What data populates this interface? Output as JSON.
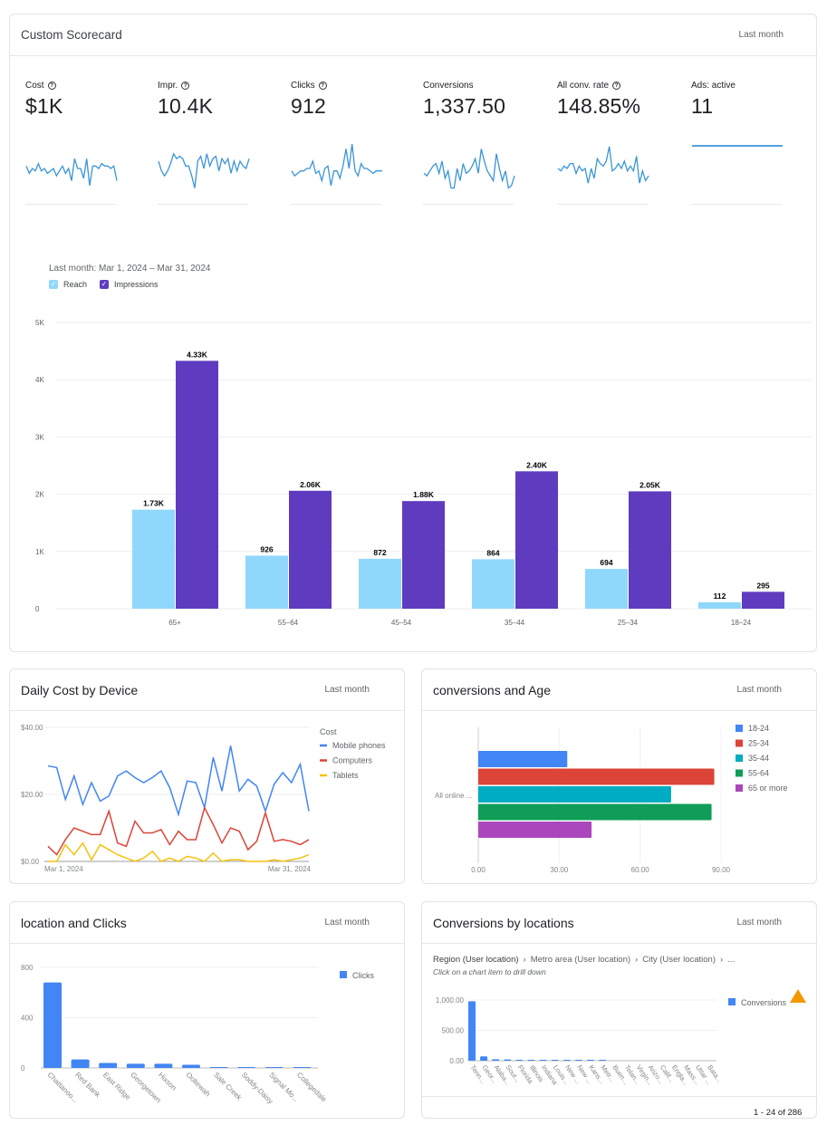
{
  "scorecard": {
    "title": "Custom Scorecard",
    "range": "Last month",
    "metrics": [
      {
        "label": "Cost",
        "value": "$1K",
        "help": true,
        "spark": [
          0.45,
          0.6,
          0.5,
          0.55,
          0.4,
          0.55,
          0.5,
          0.6,
          0.55,
          0.5,
          0.65,
          0.55,
          0.45,
          0.6,
          0.5,
          0.75,
          0.3,
          0.5,
          0.5,
          0.7,
          0.3,
          0.85,
          0.45,
          0.45,
          0.5,
          0.4,
          0.45,
          0.45,
          0.5,
          0.45,
          0.75
        ]
      },
      {
        "label": "Impr.",
        "value": "10.4K",
        "help": true,
        "spark": [
          0.35,
          0.55,
          0.65,
          0.55,
          0.4,
          0.2,
          0.3,
          0.25,
          0.3,
          0.45,
          0.45,
          0.65,
          0.9,
          0.35,
          0.25,
          0.5,
          0.2,
          0.45,
          0.3,
          0.25,
          0.55,
          0.3,
          0.4,
          0.3,
          0.6,
          0.35,
          0.55,
          0.35,
          0.45,
          0.5,
          0.3
        ]
      },
      {
        "label": "Clicks",
        "value": "912",
        "help": true,
        "spark": [
          0.55,
          0.65,
          0.6,
          0.55,
          0.55,
          0.5,
          0.5,
          0.35,
          0.6,
          0.55,
          0.75,
          0.5,
          0.45,
          0.85,
          0.55,
          0.55,
          0.7,
          0.45,
          0.1,
          0.5,
          0.0,
          0.55,
          0.65,
          0.4,
          0.5,
          0.5,
          0.55,
          0.6,
          0.55,
          0.55,
          0.55
        ]
      },
      {
        "label": "Conversions",
        "value": "1,337.50",
        "help": false,
        "spark": [
          0.6,
          0.65,
          0.55,
          0.45,
          0.4,
          0.6,
          0.35,
          0.7,
          0.55,
          0.9,
          0.9,
          0.5,
          0.75,
          0.4,
          0.6,
          0.55,
          0.45,
          0.3,
          0.6,
          0.1,
          0.35,
          0.55,
          0.65,
          0.75,
          0.2,
          0.5,
          0.75,
          0.55,
          0.9,
          0.85,
          0.65
        ]
      },
      {
        "label": "All conv. rate",
        "value": "148.85%",
        "help": true,
        "spark": [
          0.5,
          0.55,
          0.45,
          0.5,
          0.4,
          0.4,
          0.6,
          0.45,
          0.55,
          0.5,
          0.8,
          0.5,
          0.7,
          0.3,
          0.4,
          0.45,
          0.35,
          0.05,
          0.55,
          0.5,
          0.4,
          0.5,
          0.35,
          0.55,
          0.45,
          0.55,
          0.25,
          0.8,
          0.55,
          0.75,
          0.65
        ]
      },
      {
        "label": "Ads: active",
        "value": "11",
        "help": false,
        "spark": [
          0.5,
          0.5,
          0.5,
          0.5,
          0.5,
          0.5,
          0.5,
          0.5,
          0.5,
          0.5,
          0.5,
          0.5,
          0.5,
          0.5,
          0.5,
          0.5,
          0.5,
          0.5,
          0.5,
          0.5,
          0.5,
          0.5,
          0.5,
          0.5,
          0.5,
          0.5,
          0.5,
          0.5,
          0.5,
          0.5,
          0.5
        ]
      }
    ]
  },
  "chart_data": [
    {
      "id": "reach-impressions",
      "type": "bar",
      "subtitle": "Last month: Mar 1, 2024 – Mar 31, 2024",
      "categories": [
        "65+",
        "55–64",
        "45–54",
        "35–44",
        "25–34",
        "18–24"
      ],
      "series": [
        {
          "name": "Reach",
          "color": "#8fd8fc",
          "values": [
            1730,
            926,
            872,
            864,
            694,
            112
          ],
          "labels": [
            "1.73K",
            "926",
            "872",
            "864",
            "694",
            "112"
          ]
        },
        {
          "name": "Impressions",
          "color": "#5e3bbf",
          "values": [
            4330,
            2060,
            1880,
            2400,
            2050,
            295
          ],
          "labels": [
            "4.33K",
            "2.06K",
            "1.88K",
            "2.40K",
            "2.05K",
            "295"
          ]
        }
      ],
      "yticks": [
        "0",
        "1K",
        "2K",
        "3K",
        "4K",
        "5K"
      ],
      "ylim": [
        0,
        5000
      ],
      "grid": true,
      "legend": "top-left"
    },
    {
      "id": "daily-cost-by-device",
      "type": "line",
      "title": "Daily Cost by Device",
      "range": "Last month",
      "legend_title": "Cost",
      "xlabels": [
        "Mar 1, 2024",
        "Mar 31, 2024"
      ],
      "yticks": [
        "$0.00",
        "$20.00",
        "$40.00"
      ],
      "ylim": [
        0,
        40
      ],
      "grid": true,
      "legend": "right",
      "series": [
        {
          "name": "Mobile phones",
          "color": "#4285f4",
          "values": [
            28.5,
            28,
            18.5,
            25.5,
            17,
            23.5,
            18,
            19.5,
            25.5,
            27,
            25,
            23.5,
            25,
            27,
            22,
            14,
            24,
            23.5,
            16,
            31,
            21,
            34.5,
            21,
            24.5,
            22.5,
            15,
            23,
            26.5,
            23.5,
            29,
            15
          ]
        },
        {
          "name": "Computers",
          "color": "#db4437",
          "values": [
            4.5,
            2,
            6.5,
            10,
            9,
            8,
            8,
            15,
            5.5,
            4.5,
            12,
            8.5,
            8.5,
            9.5,
            5,
            9,
            6.5,
            6.5,
            16,
            11,
            5.5,
            10,
            9,
            3.5,
            6,
            14.5,
            6,
            6.5,
            6,
            5,
            6.5
          ]
        },
        {
          "name": "Tablets",
          "color": "#f4c20d",
          "values": [
            0,
            0,
            5,
            2,
            5.5,
            0.5,
            5,
            3.5,
            2,
            1,
            0,
            1,
            3,
            0,
            1,
            0,
            1.5,
            1,
            0,
            2.5,
            0,
            0.5,
            0.5,
            0,
            0,
            0,
            0.5,
            0,
            0.5,
            1,
            2
          ]
        }
      ]
    },
    {
      "id": "conversions-and-age",
      "type": "bar",
      "orientation": "horizontal",
      "title": "conversions and Age",
      "range": "Last month",
      "category": "All online ...",
      "xticks": [
        "0.00",
        "30.00",
        "60.00",
        "90.00"
      ],
      "xlim": [
        0,
        90
      ],
      "grid": true,
      "legend": "right",
      "series": [
        {
          "name": "18-24",
          "color": "#4285f4",
          "value": 33
        },
        {
          "name": "25-34",
          "color": "#db4437",
          "value": 87.5
        },
        {
          "name": "35-44",
          "color": "#00acc1",
          "value": 71.5
        },
        {
          "name": "55-64",
          "color": "#0f9d58",
          "value": 86.5
        },
        {
          "name": "65 or more",
          "color": "#ab47bc",
          "value": 42
        }
      ]
    },
    {
      "id": "location-and-clicks",
      "type": "bar",
      "title": "location and Clicks",
      "range": "Last month",
      "categories": [
        "Chattanoo...",
        "Red Bank",
        "East Ridge",
        "Georgetown",
        "Hixson",
        "Ooltewah",
        "Sale Creek",
        "Soddy-Daisy",
        "Signal Mo...",
        "Collegedale"
      ],
      "series": [
        {
          "name": "Clicks",
          "color": "#4285f4",
          "values": [
            680,
            68,
            40,
            33,
            33,
            25,
            5,
            5,
            1,
            1
          ]
        }
      ],
      "yticks": [
        "0",
        "400",
        "800"
      ],
      "ylim": [
        0,
        800
      ],
      "grid": true,
      "legend": "right"
    },
    {
      "id": "conversions-by-locations",
      "type": "bar",
      "title": "Conversions by locations",
      "range": "Last month",
      "categories": [
        "Tenn...",
        "Geor...",
        "Alaba...",
        "Sout...",
        "Florida",
        "Illinois",
        "Indiana",
        "Louis...",
        "New ...",
        "New ...",
        "Kans...",
        "Metr...",
        "Buen...",
        "Telan...",
        "Virgin...",
        "Arizo...",
        "Calif...",
        "Engla...",
        "Mass...",
        "Uttar ...",
        "Bata..."
      ],
      "series": [
        {
          "name": "Conversions",
          "color": "#4285f4",
          "values": [
            980,
            70,
            25,
            20,
            8,
            6,
            6,
            5,
            5,
            5,
            4,
            4,
            0,
            0,
            0,
            0,
            0,
            0,
            0,
            0,
            0
          ]
        }
      ],
      "yticks": [
        "0.00",
        "500.00",
        "1,000.00"
      ],
      "ylim": [
        0,
        1000
      ],
      "grid": true,
      "legend": "right"
    }
  ],
  "drill": {
    "crumbs": [
      "Region (User location)",
      "Metro area (User location)",
      "City (User location)",
      "..."
    ],
    "hint": "Click on a chart item to drill down"
  },
  "pagination": "1 - 24 of 286",
  "warning_icon": "warning-triangle-icon"
}
